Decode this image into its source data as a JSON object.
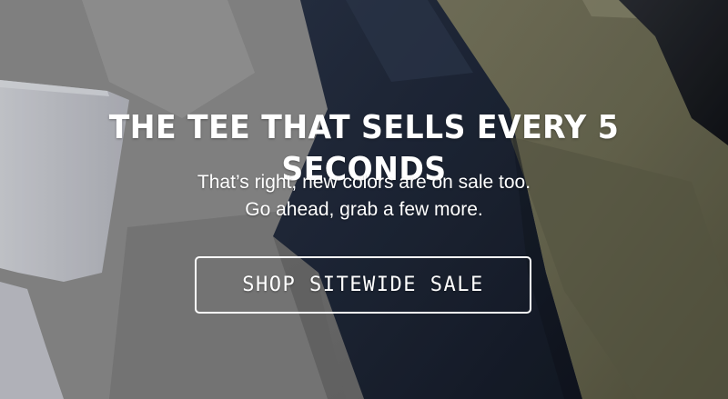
{
  "hero": {
    "title": "THE TEE THAT SELLS EVERY 5 SECONDS",
    "subtitle_line1": "That’s right, new colors are on sale too.",
    "subtitle_line2": "Go ahead, grab a few more.",
    "cta_label": "SHOP SITEWIDE SALE"
  },
  "colors": {
    "text": "#ffffff",
    "tee_gray": "#8a8a8a",
    "tee_navy": "#1e2738",
    "tee_olive": "#6b6a52",
    "tee_light": "#c9cbd2"
  }
}
